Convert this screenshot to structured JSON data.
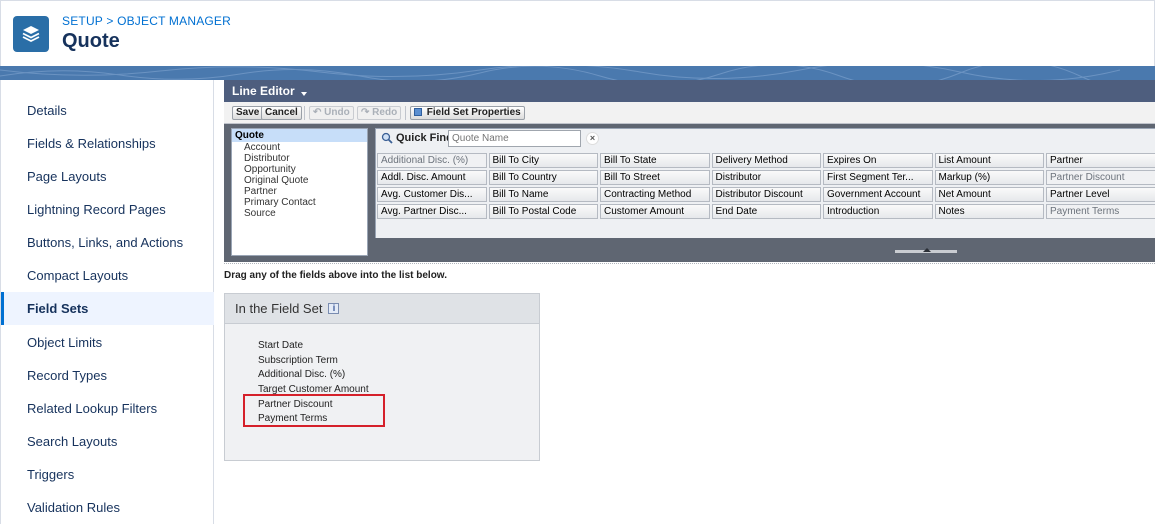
{
  "header": {
    "breadcrumb": "SETUP > OBJECT MANAGER",
    "title": "Quote",
    "icon": "layers-icon",
    "icon_color": "#2a6ea7"
  },
  "sidebar": {
    "items": [
      {
        "label": "Details",
        "active": false
      },
      {
        "label": "Fields & Relationships",
        "active": false
      },
      {
        "label": "Page Layouts",
        "active": false
      },
      {
        "label": "Lightning Record Pages",
        "active": false
      },
      {
        "label": "Buttons, Links, and Actions",
        "active": false
      },
      {
        "label": "Compact Layouts",
        "active": false
      },
      {
        "label": "Field Sets",
        "active": true
      },
      {
        "label": "Object Limits",
        "active": false
      },
      {
        "label": "Record Types",
        "active": false
      },
      {
        "label": "Related Lookup Filters",
        "active": false
      },
      {
        "label": "Search Layouts",
        "active": false
      },
      {
        "label": "Triggers",
        "active": false
      },
      {
        "label": "Validation Rules",
        "active": false
      }
    ]
  },
  "line_editor": {
    "title": "Line Editor",
    "toolbar": {
      "save": "Save",
      "cancel": "Cancel",
      "undo": "Undo",
      "redo": "Redo",
      "field_set_properties": "Field Set Properties"
    },
    "objects": {
      "selected": "Quote",
      "items": [
        "Account",
        "Distributor",
        "Opportunity",
        "Original Quote",
        "Partner",
        "Primary Contact",
        "Source"
      ]
    },
    "quick_find": {
      "label": "Quick Find",
      "placeholder": "Quote Name"
    },
    "field_columns": [
      [
        "Additional Disc. (%)",
        "Addl. Disc. Amount",
        "Avg. Customer Dis...",
        "Avg. Partner Disc..."
      ],
      [
        "Bill To City",
        "Bill To Country",
        "Bill To Name",
        "Bill To Postal Code"
      ],
      [
        "Bill To State",
        "Bill To Street",
        "Contracting Method",
        "Customer Amount"
      ],
      [
        "Delivery Method",
        "Distributor",
        "Distributor Discount",
        "End Date"
      ],
      [
        "Expires On",
        "First Segment Ter...",
        "Government Account",
        "Introduction"
      ],
      [
        "List Amount",
        "Markup (%)",
        "Net Amount",
        "Notes"
      ],
      [
        "Partner",
        "Partner Discount",
        "Partner Level",
        "Payment Terms"
      ]
    ],
    "disabled_fields": [
      "Additional Disc. (%)",
      "Partner Discount",
      "Payment Terms"
    ]
  },
  "instruction": "Drag any of the fields above into the list below.",
  "field_set": {
    "title": "In the Field Set",
    "info_icon": "i",
    "fields": [
      "Start Date",
      "Subscription Term",
      "Additional Disc. (%)",
      "Target Customer Amount",
      "Partner Discount",
      "Payment Terms"
    ],
    "highlight_color": "#d5202a"
  }
}
